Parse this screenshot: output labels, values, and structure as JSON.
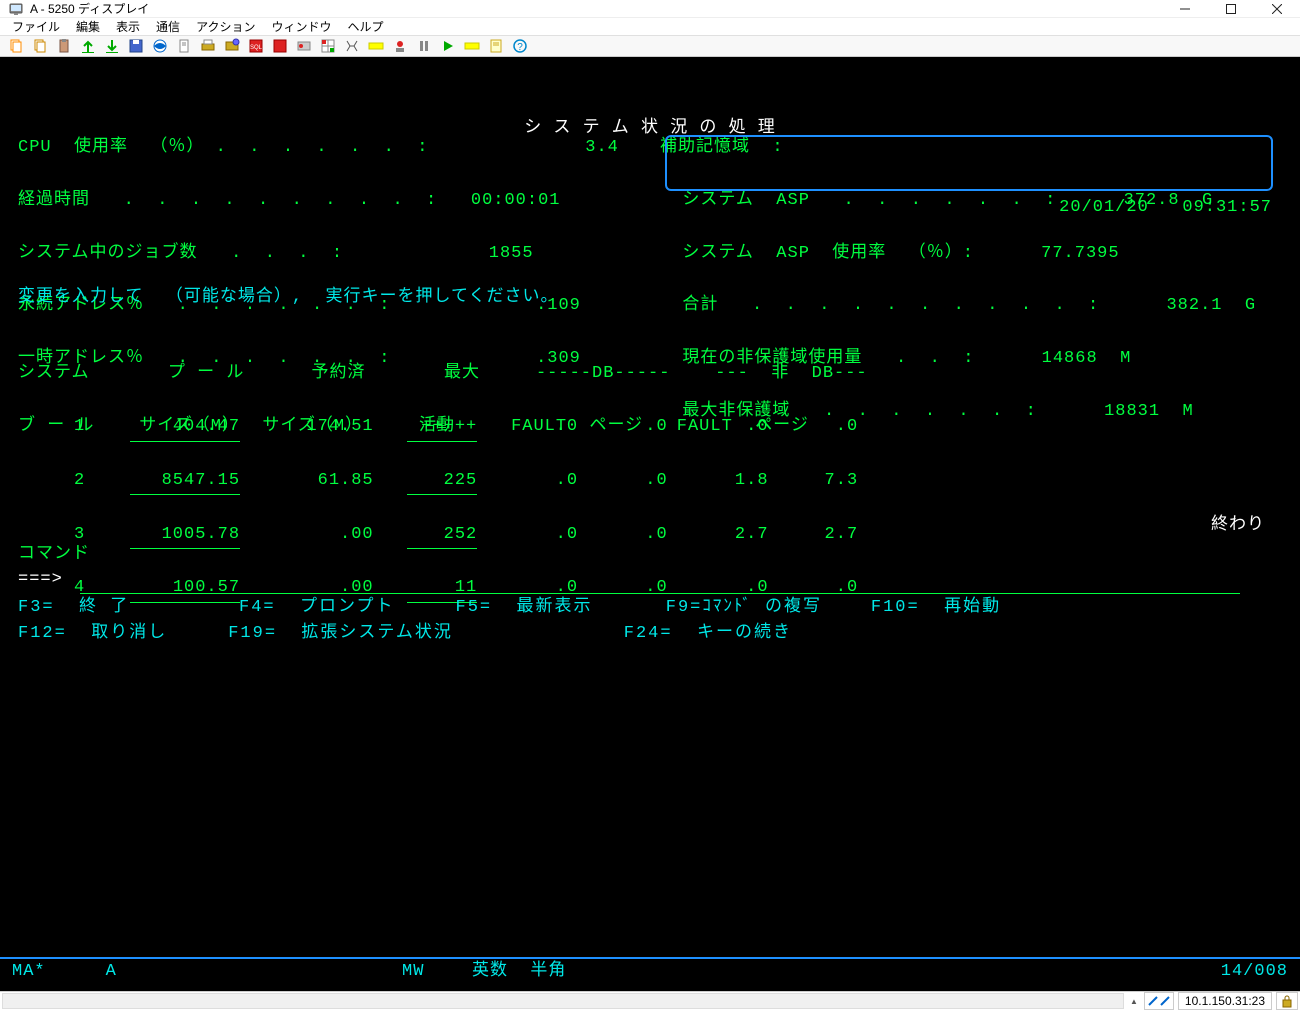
{
  "window": {
    "title": "A - 5250 ディスプレイ"
  },
  "menu": {
    "file": "ファイル",
    "edit": "編集",
    "view": "表示",
    "comm": "通信",
    "action": "アクション",
    "window": "ウィンドウ",
    "help": "ヘルプ"
  },
  "terminal": {
    "header_title": "シ ス テ ム 状 況 の 処 理",
    "datetime": "20/01/20   09:31:57",
    "cpu_label": "CPU  使用率  （％） .  .  .  .  .  .  :",
    "cpu_value": "3.4",
    "elapsed_label": "経過時間   .  .  .  .  .  .  .  .  .  :",
    "elapsed_value": "00:00:01",
    "jobs_label": "システム中のジョブ数   .  .  .  :",
    "jobs_value": "1855",
    "permaddr_label": "永続アドレス％   .  .  .  .  .  .  :",
    "permaddr_value": ".109",
    "tempaddr_label": "一時アドレス％   .  .  .  .  .  .  :",
    "tempaddr_value": ".309",
    "aux_label": "補助記憶域  :",
    "sys_asp_label": "システム  ASP   .  .  .  .  .  .  :",
    "sys_asp_value": "372.8  G",
    "sys_asp_use_label": "システム  ASP  使用率  （％）:",
    "sys_asp_use_value": "77.7395",
    "total_label": "合計   .  .  .  .  .  .  .  .  .  .  :",
    "total_value": "382.1  G",
    "unprot_now_label": "現在の非保護域使用量   .  .  :",
    "unprot_now_value": "14868  M",
    "unprot_max_label": "最大非保護域   .  .  .  .  .  .  :",
    "unprot_max_value": "18831  M",
    "instruction": "変更を入力して  （可能な場合）,  実行キーを押してください。",
    "col_h1a": "システム",
    "col_h1b": "プ ー ル",
    "col_h1c": "予約済",
    "col_h1d": "最大",
    "col_db": "-----DB-----",
    "col_ndb": "---  非  DB---",
    "col_h2a": "ブ ー ル",
    "col_h2b": "サイズ（M）",
    "col_h2c": "サイズ（M）",
    "col_h2d": "活動",
    "col_fault": "FAULT",
    "col_page": "ページ",
    "rows": [
      {
        "pool": "1",
        "size": "404.47",
        "res": "174.51",
        "act": "+++++",
        "dbf": ".0",
        "dbp": ".0",
        "nf": ".0",
        "np": ".0"
      },
      {
        "pool": "2",
        "size": "8547.15",
        "res": "61.85",
        "act": "225",
        "dbf": ".0",
        "dbp": ".0",
        "nf": "1.8",
        "np": "7.3"
      },
      {
        "pool": "3",
        "size": "1005.78",
        "res": ".00",
        "act": "252",
        "dbf": ".0",
        "dbp": ".0",
        "nf": "2.7",
        "np": "2.7"
      },
      {
        "pool": "4",
        "size": "100.57",
        "res": ".00",
        "act": "11",
        "dbf": ".0",
        "dbp": ".0",
        "nf": ".0",
        "np": ".0"
      }
    ],
    "end_label": "終わり",
    "cmd_label": "コマンド",
    "prompt": "===> ",
    "fkeys1": "F3=  終 了         F4=  プロンプト     F5=  最新表示      F9=ｺﾏﾝﾄﾞ の複写    F10=  再始動",
    "fkeys2": "F12=  取り消し     F19=  拡張システム状況              F24=  キーの続き",
    "status_ma": "MA*",
    "status_a": "A",
    "status_mw": "MW",
    "status_mode": "英数  半角",
    "status_pos": "14/008"
  },
  "footer": {
    "ip": "10.1.150.31:23"
  }
}
